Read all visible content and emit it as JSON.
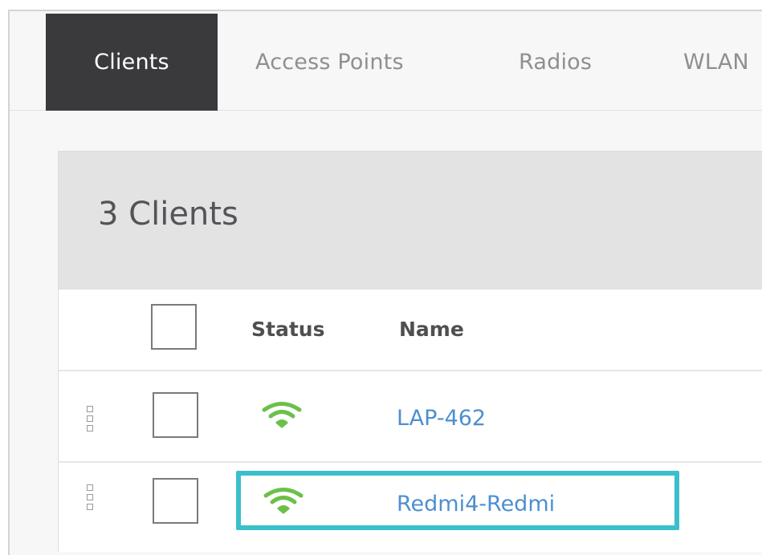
{
  "tabs": [
    {
      "label": "Clients",
      "active": true
    },
    {
      "label": "Access Points",
      "active": false
    },
    {
      "label": "Radios",
      "active": false
    },
    {
      "label": "WLAN",
      "active": false
    }
  ],
  "list": {
    "title": "3 Clients",
    "columns": {
      "status": "Status",
      "name": "Name"
    }
  },
  "rows": [
    {
      "status_icon": "wifi-icon",
      "status_color": "#6cc04a",
      "name": "LAP-462",
      "highlighted": false
    },
    {
      "status_icon": "wifi-icon",
      "status_color": "#6cc04a",
      "name": "Redmi4-Redmi",
      "highlighted": true
    }
  ],
  "colors": {
    "active_tab_bg": "#3a3a3d",
    "link": "#4d8fcf",
    "highlight": "#3bbfcb"
  }
}
